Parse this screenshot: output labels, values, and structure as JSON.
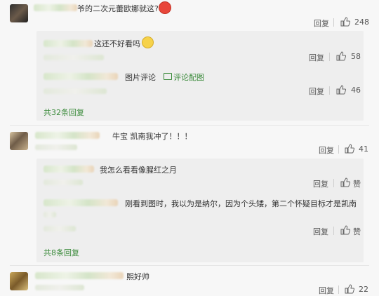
{
  "comments": [
    {
      "text": "爷的二次元蕾欧娜就这?",
      "reply_label": "回复",
      "likes": "248",
      "replies": [
        {
          "text": "这还不好看吗",
          "reply_label": "回复",
          "likes": "58"
        },
        {
          "pic_label": "图片评论",
          "pic_link": "评论配图",
          "reply_label": "回复",
          "likes": "46"
        }
      ],
      "more": "共32条回复"
    },
    {
      "text": "牛宝 凯南我冲了！！！",
      "reply_label": "回复",
      "likes": "41",
      "replies": [
        {
          "text": "我怎么看看像腥红之月",
          "reply_label": "回复",
          "likes": "赞"
        },
        {
          "text": "刚看到图时，我以为是纳尔，因为个头矮，第二个怀疑目标才是凯南",
          "reply_label": "回复",
          "likes": "赞"
        }
      ],
      "more": "共8条回复"
    },
    {
      "text": "熙好帅",
      "reply_label": "回复",
      "likes": "22"
    }
  ],
  "colors": {
    "link": "#3a8a3a",
    "background": "#f7f7f7",
    "reply_bg": "#eeeeee"
  }
}
